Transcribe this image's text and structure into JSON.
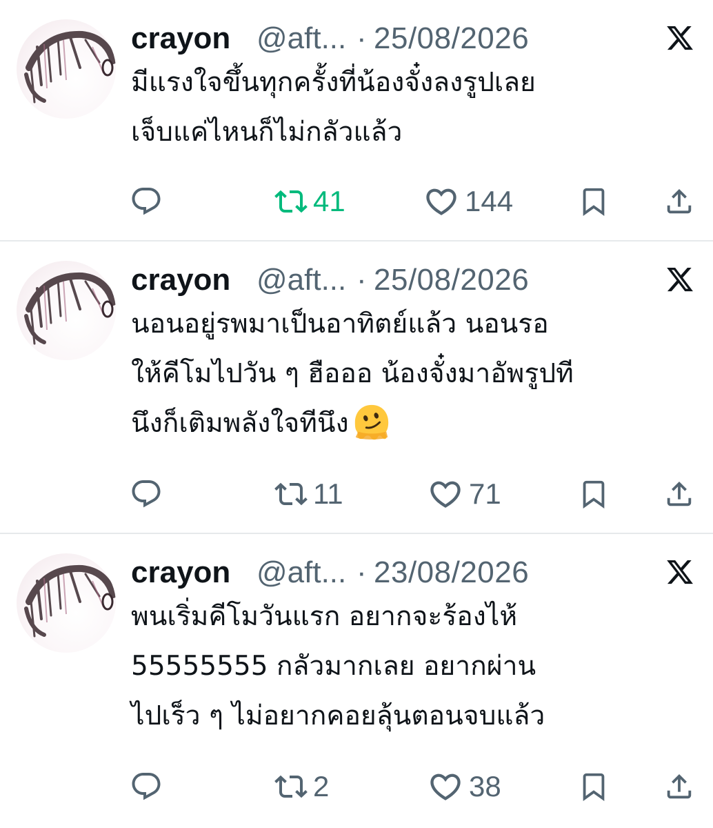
{
  "tweets": [
    {
      "name": "crayon",
      "handle": "@aft...",
      "separator": "·",
      "date": "25/08/2026",
      "lines": [
        "มีแรงใจขึ้นทุกครั้งที่น้องจั๋งลงรูปเลย",
        "เจ็บแค่ไหนก็ไม่กลัวแล้ว"
      ],
      "emoji": null,
      "retweets": "41",
      "likes": "144",
      "retweeted": true
    },
    {
      "name": "crayon",
      "handle": "@aft...",
      "separator": "·",
      "date": "25/08/2026",
      "lines": [
        "นอนอยู่รพมาเป็นอาทิตย์แล้ว นอนรอ",
        "ให้คีโมไปวัน ๆ ฮือออ น้องจั๋งมาอัพรูปที",
        "นึงก็เติมพลังใจทีนึง"
      ],
      "emoji": "melting-face",
      "retweets": "11",
      "likes": "71",
      "retweeted": false
    },
    {
      "name": "crayon",
      "handle": "@aft...",
      "separator": "·",
      "date": "23/08/2026",
      "lines": [
        "พนเริ่มคีโมวันแรก อยากจะร้องไห้",
        "55555555 กลัวมากเลย อยากผ่าน",
        "ไปเร็ว ๆ ไม่อยากคอยลุ้นตอนจบแล้ว"
      ],
      "emoji": null,
      "retweets": "2",
      "likes": "38",
      "retweeted": false
    }
  ],
  "colors": {
    "text": "#0f1419",
    "muted": "#536471",
    "retweet_active": "#00ba7c",
    "divider": "#e6e9eb"
  },
  "icons": [
    "reply-icon",
    "retweet-icon",
    "like-icon",
    "bookmark-icon",
    "share-icon",
    "x-logo-icon"
  ]
}
